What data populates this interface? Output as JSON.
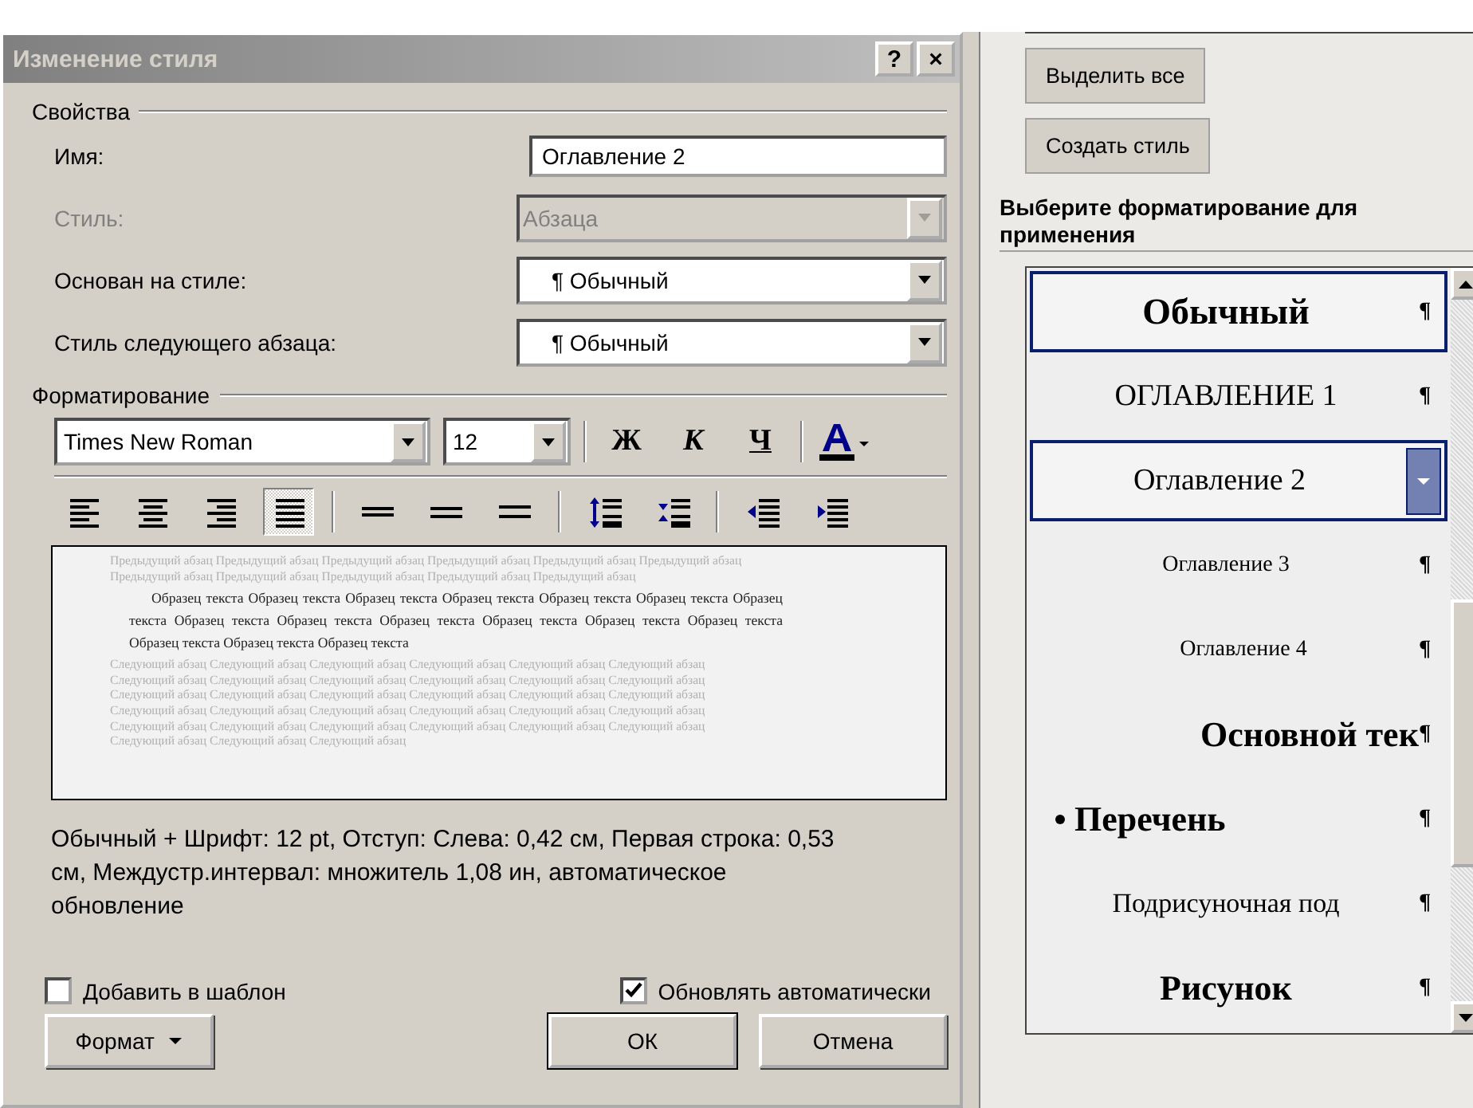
{
  "dialog": {
    "title": "Изменение стиля",
    "title_buttons": [
      "?",
      "×"
    ],
    "properties": {
      "legend": "Свойства",
      "rows": [
        {
          "label": "Имя:",
          "kind": "text",
          "value": "Оглавление 2",
          "disabled": false
        },
        {
          "label": "Стиль:",
          "kind": "combo",
          "value": "Абзаца",
          "disabled": true
        },
        {
          "label": "Основан на стиле:",
          "kind": "combo",
          "value": "¶ Обычный",
          "disabled": false
        },
        {
          "label": "Стиль следующего абзаца:",
          "kind": "combo",
          "value": "¶ Обычный",
          "disabled": false
        }
      ]
    },
    "formatting": {
      "legend": "Форматирование",
      "font": "Times New Roman",
      "size": "12",
      "style_buttons": [
        "Ж",
        "К",
        "Ч"
      ],
      "tool_groups": [
        [
          {
            "kind": "align-left",
            "pressed": false
          },
          {
            "kind": "align-center",
            "pressed": false
          },
          {
            "kind": "align-right",
            "pressed": false
          },
          {
            "kind": "justify",
            "pressed": true
          }
        ],
        [
          {
            "kind": "single-spacing",
            "pressed": false
          },
          {
            "kind": "one-half-spacing",
            "pressed": false
          },
          {
            "kind": "double-spacing",
            "pressed": false
          }
        ],
        [
          {
            "kind": "space-before",
            "pressed": false
          },
          {
            "kind": "space-after",
            "pressed": false
          }
        ],
        [
          {
            "kind": "outdent",
            "pressed": false
          },
          {
            "kind": "indent",
            "pressed": false
          }
        ]
      ]
    },
    "preview": {
      "previous": "Предыдущий абзац Предыдущий абзац Предыдущий абзац Предыдущий абзац Предыдущий абзац Предыдущий абзац Предыдущий абзац Предыдущий абзац Предыдущий абзац Предыдущий абзац Предыдущий абзац",
      "sample": "Образец текста Образец текста Образец текста Образец текста Образец текста Образец текста Образец текста Образец текста Образец текста Образец текста Образец текста Образец текста Образец текста Образец текста Образец текста Образец текста",
      "next": "Следующий абзац Следующий абзац Следующий абзац Следующий абзац Следующий абзац Следующий абзац Следующий абзац Следующий абзац Следующий абзац Следующий абзац Следующий абзац Следующий абзац Следующий абзац Следующий абзац Следующий абзац Следующий абзац Следующий абзац Следующий абзац Следующий абзац Следующий абзац Следующий абзац Следующий абзац Следующий абзац Следующий абзац Следующий абзац Следующий абзац Следующий абзац Следующий абзац Следующий абзац Следующий абзац Следующий абзац Следующий абзац Следующий абзац"
    },
    "description": "Обычный + Шрифт: 12 pt, Отступ: Слева:  0,42 см, Первая строка:  0,53 см, Междустр.интервал:  множитель 1,08 ин, автоматическое обновление",
    "checkboxes": [
      {
        "label": "Добавить в шаблон",
        "checked": false
      },
      {
        "label": "Обновлять автоматически",
        "checked": true
      }
    ],
    "format_button": "Формат",
    "buttons": [
      "ОК",
      "Отмена"
    ]
  },
  "task_pane": {
    "buttons": [
      "Выделить все",
      "Создать стиль"
    ],
    "heading": "Выберите форматирование для применения",
    "styles": [
      {
        "label": "Обычный",
        "kind": "normal",
        "mark": "¶",
        "outlined": true,
        "selected": false
      },
      {
        "label": "ОГЛАВЛЕНИЕ 1",
        "kind": "toc1",
        "mark": "¶",
        "outlined": false,
        "selected": false
      },
      {
        "label": "Оглавление 2",
        "kind": "toc2",
        "outlined": true,
        "selected": true
      },
      {
        "label": "Оглавление 3",
        "kind": "toc3",
        "mark": "¶",
        "outlined": false,
        "selected": false
      },
      {
        "label": "Оглавление 4",
        "kind": "toc4",
        "mark": "¶",
        "outlined": false,
        "selected": false
      },
      {
        "label": "Основной тек",
        "kind": "body",
        "mark": "¶",
        "outlined": false,
        "selected": false
      },
      {
        "label": "Перечень",
        "kind": "list",
        "mark": "¶",
        "outlined": false,
        "selected": false
      },
      {
        "label": "Подрисуночная под",
        "kind": "caption",
        "mark": "¶",
        "outlined": false,
        "selected": false
      },
      {
        "label": "Рисунок",
        "kind": "figure",
        "mark": "¶",
        "outlined": false,
        "selected": false
      }
    ]
  }
}
